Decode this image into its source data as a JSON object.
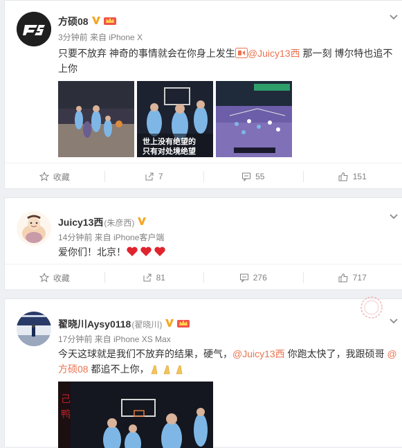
{
  "posts": [
    {
      "name": "方硕08",
      "meta": "3分钟前 来自 iPhone X",
      "text1": "只要不放弃 神奇的事情就会在你身上发生",
      "mention1": "@Juicy13西",
      "text2": " 那一刻 博尔特也追不上你",
      "overlay_line1": "世上没有绝望的",
      "overlay_line2": "只有对处境绝望",
      "actions": {
        "fav": "收藏",
        "repost": "7",
        "comment": "55",
        "like": "151"
      }
    },
    {
      "name": "Juicy13西",
      "remark": "(朱彦西)",
      "meta": "14分钟前 来自 iPhone客户端",
      "text1": "爱你们！北京！",
      "actions": {
        "fav": "收藏",
        "repost": "81",
        "comment": "276",
        "like": "717"
      }
    },
    {
      "name": "翟晓川Aysy0118",
      "remark": "(翟晓川)",
      "meta": "17分钟前 来自 iPhone XS Max",
      "text1": "今天这球就是我们不放弃的结果，硬气，",
      "mention1": "@Juicy13西",
      "text2": " 你跑太快了，我跟硕哥 ",
      "mention2": "@方硕08",
      "text3": " 都追不上你，"
    }
  ],
  "colors": {
    "mention": "#eb7350",
    "vip_gold": "#f5a623",
    "team_blue": "#7eb7e6"
  }
}
